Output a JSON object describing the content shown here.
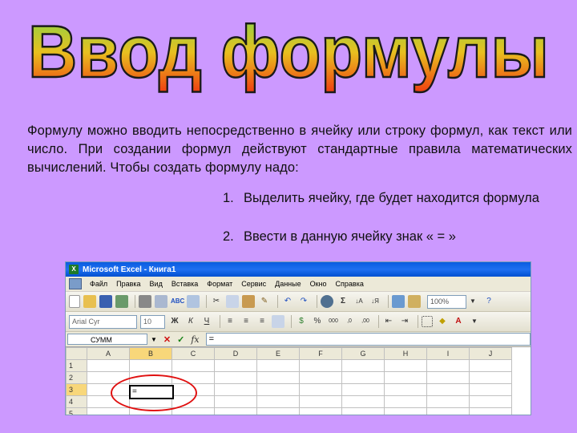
{
  "slide": {
    "title": "Ввод формулы",
    "paragraph": "Формулу можно вводить непосредственно в ячейку или строку формул, как текст или число. При создании формул действуют стандартные правила математических вычислений. Чтобы создать формулу надо:",
    "steps": [
      {
        "num": "1.",
        "text": "Выделить ячейку, где будет находится формула"
      },
      {
        "num": "2.",
        "text": "Ввести в данную ячейку знак « = »"
      }
    ]
  },
  "excel": {
    "title": "Microsoft Excel - Книга1",
    "menu": [
      "Файл",
      "Правка",
      "Вид",
      "Вставка",
      "Формат",
      "Сервис",
      "Данные",
      "Окно",
      "Справка"
    ],
    "zoom": "100%",
    "font": "Arial Cyr",
    "font_size": "10",
    "name_box": "СУММ",
    "formula": "=",
    "columns": [
      "A",
      "B",
      "C",
      "D",
      "E",
      "F",
      "G",
      "H",
      "I",
      "J"
    ],
    "rows": [
      "1",
      "2",
      "3",
      "4",
      "5"
    ],
    "active_cell_value": "=",
    "colors": {
      "title_bar": "#0a5ce0",
      "highlight_oval": "#e01010",
      "background": "#cc99ff"
    }
  }
}
